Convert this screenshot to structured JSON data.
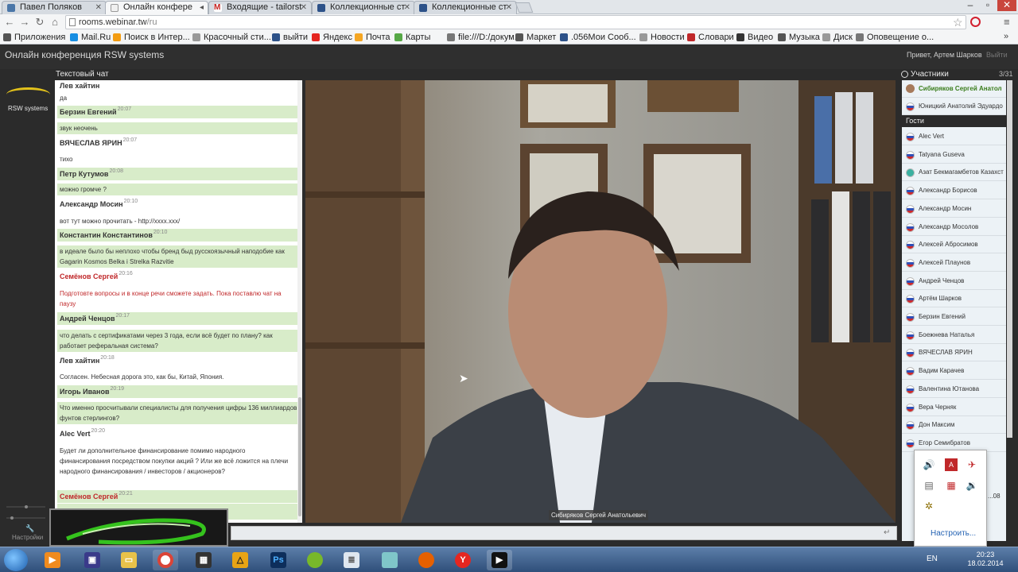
{
  "browser": {
    "tabs": [
      {
        "label": "Павел Поляков",
        "color": "#4a76a8"
      },
      {
        "label": "Онлайн конфере",
        "color": "#f0f0f0"
      },
      {
        "label": "Входящие - tailorst",
        "color": "#c5221f"
      },
      {
        "label": "Коллекционные ст",
        "color": "#2d5289"
      },
      {
        "label": "Коллекционные ст",
        "color": "#2d5289"
      }
    ],
    "url_host": "rooms.webinar.tw",
    "url_path": "/ru",
    "bookmarks": [
      {
        "label": "Приложения",
        "color": "#555"
      },
      {
        "label": "Mail.Ru",
        "color": "#168de2"
      },
      {
        "label": "Поиск в Интер...",
        "color": "#f39c12"
      },
      {
        "label": "Красочный сти...",
        "color": "#999"
      },
      {
        "label": "выйти",
        "color": "#2d5289"
      },
      {
        "label": "Яндекс",
        "color": "#e52620"
      },
      {
        "label": "Почта",
        "color": "#f5a623"
      },
      {
        "label": "Карты",
        "color": "#56a846"
      },
      {
        "label": "file:///D:/докум...",
        "color": "#777"
      },
      {
        "label": "Маркет",
        "color": "#555"
      },
      {
        "label": ".056Мои Сооб...",
        "color": "#2d5289"
      },
      {
        "label": "Новости",
        "color": "#999"
      },
      {
        "label": "Словари",
        "color": "#c0282a"
      },
      {
        "label": "Видео",
        "color": "#333"
      },
      {
        "label": "Музыка",
        "color": "#555"
      },
      {
        "label": "Диск",
        "color": "#999"
      },
      {
        "label": "Оповещение о...",
        "color": "#777"
      }
    ],
    "bookmarks_more": "»"
  },
  "header": {
    "title": "Онлайн конференция RSW systems",
    "greeting": "Привет, Артем Шарков",
    "logout": "Выйти"
  },
  "sidebar": {
    "logo_text": "RSW systems",
    "settings_label": "Настройки"
  },
  "chat": {
    "label": "Текстовый чат",
    "messages": [
      {
        "author": "Лев хайтин",
        "time": "",
        "text": "да",
        "style": "plain"
      },
      {
        "author": "Берзин Евгений",
        "time": "20:07",
        "text": "звук неочень",
        "style": "green"
      },
      {
        "author": "ВЯЧЕСЛАВ ЯРИН",
        "time": "20:07",
        "text": "тихо",
        "style": "plain"
      },
      {
        "author": "Петр Кутумов",
        "time": "20:08",
        "text": "можно громче ?",
        "style": "green"
      },
      {
        "author": "Александр Мосин",
        "time": "20:10",
        "text": "вот тут можно прочитать - http://xxxx.xxx/",
        "style": "plain"
      },
      {
        "author": "Константин Константинов",
        "time": "20:10",
        "text": "в идеале было бы неплохо чтобы бренд быд русскоязычный наподобие как Gagarin Kosmos Belka i Strelka Razvitie",
        "style": "green"
      },
      {
        "author": "Семёнов Сергей",
        "time": "20:16",
        "text": "Подготовте вопросы и в конце речи сможете задать. Пока поставлю чат на паузу",
        "style": "red"
      },
      {
        "author": "Андрей Ченцов",
        "time": "20:17",
        "text": "что делать с сертификатами через 3 года, если всё будет по плану? как работает реферальная система?",
        "style": "green"
      },
      {
        "author": "Лев хайтин",
        "time": "20:18",
        "text": "Согласен. Небесная дорога это, как бы, Китай, Япония.",
        "style": "plain"
      },
      {
        "author": "Игорь Иванов",
        "time": "20:19",
        "text": "Что именно просчитывали специалисты для получения цифры 136 миллиардов фунтов стерлингов?",
        "style": "green"
      },
      {
        "author": "Alec Vert",
        "time": "20:20",
        "text": "Будет ли дополнительное финансирование помимо народного финансирования посредством покупки акций ? Или же всё ложится на плечи народного финансирования / инвесторов / акционеров?",
        "style": "plain"
      },
      {
        "author": "Семёнов Сергей",
        "time": "20:21",
        "text": "",
        "style": "red-green"
      }
    ]
  },
  "video": {
    "caption": "Сибиряков Сергей Анатольевич"
  },
  "participants": {
    "title": "Участники",
    "count": "3/31",
    "organizers": [
      "Сибиряков Сергей Анатол",
      "Юницкий Анатолий Эдуардо"
    ],
    "guests_label": "Гости",
    "guests": [
      "Alec Vert",
      "Tatyana Guseva",
      "Азат Бекмагамбетов Казахст",
      "Александр Борисов",
      "Александр Мосин",
      "Александр Мосолов",
      "Алексей Абросимов",
      "Алексей Плаунов",
      "Андрей Ченцов",
      "Артём Шарков",
      "Берзин Евгений",
      "Боежнева Наталья",
      "ВЯЧЕСЛАВ ЯРИН",
      "Вадим Карачев",
      "Валентина Ютанова",
      "Вера Черняк",
      "Дон Максим",
      "Егор Семибратов"
    ]
  },
  "tray": {
    "customize": "Настроить...",
    "partial_text": "...08"
  },
  "taskbar": {
    "lang": "EN",
    "time": "20:23",
    "date": "18.02.2014"
  },
  "colors": {
    "accent_green": "#d8ecc9",
    "moderator_red": "#c0282a",
    "logo_yellow": "#e3c21b"
  }
}
